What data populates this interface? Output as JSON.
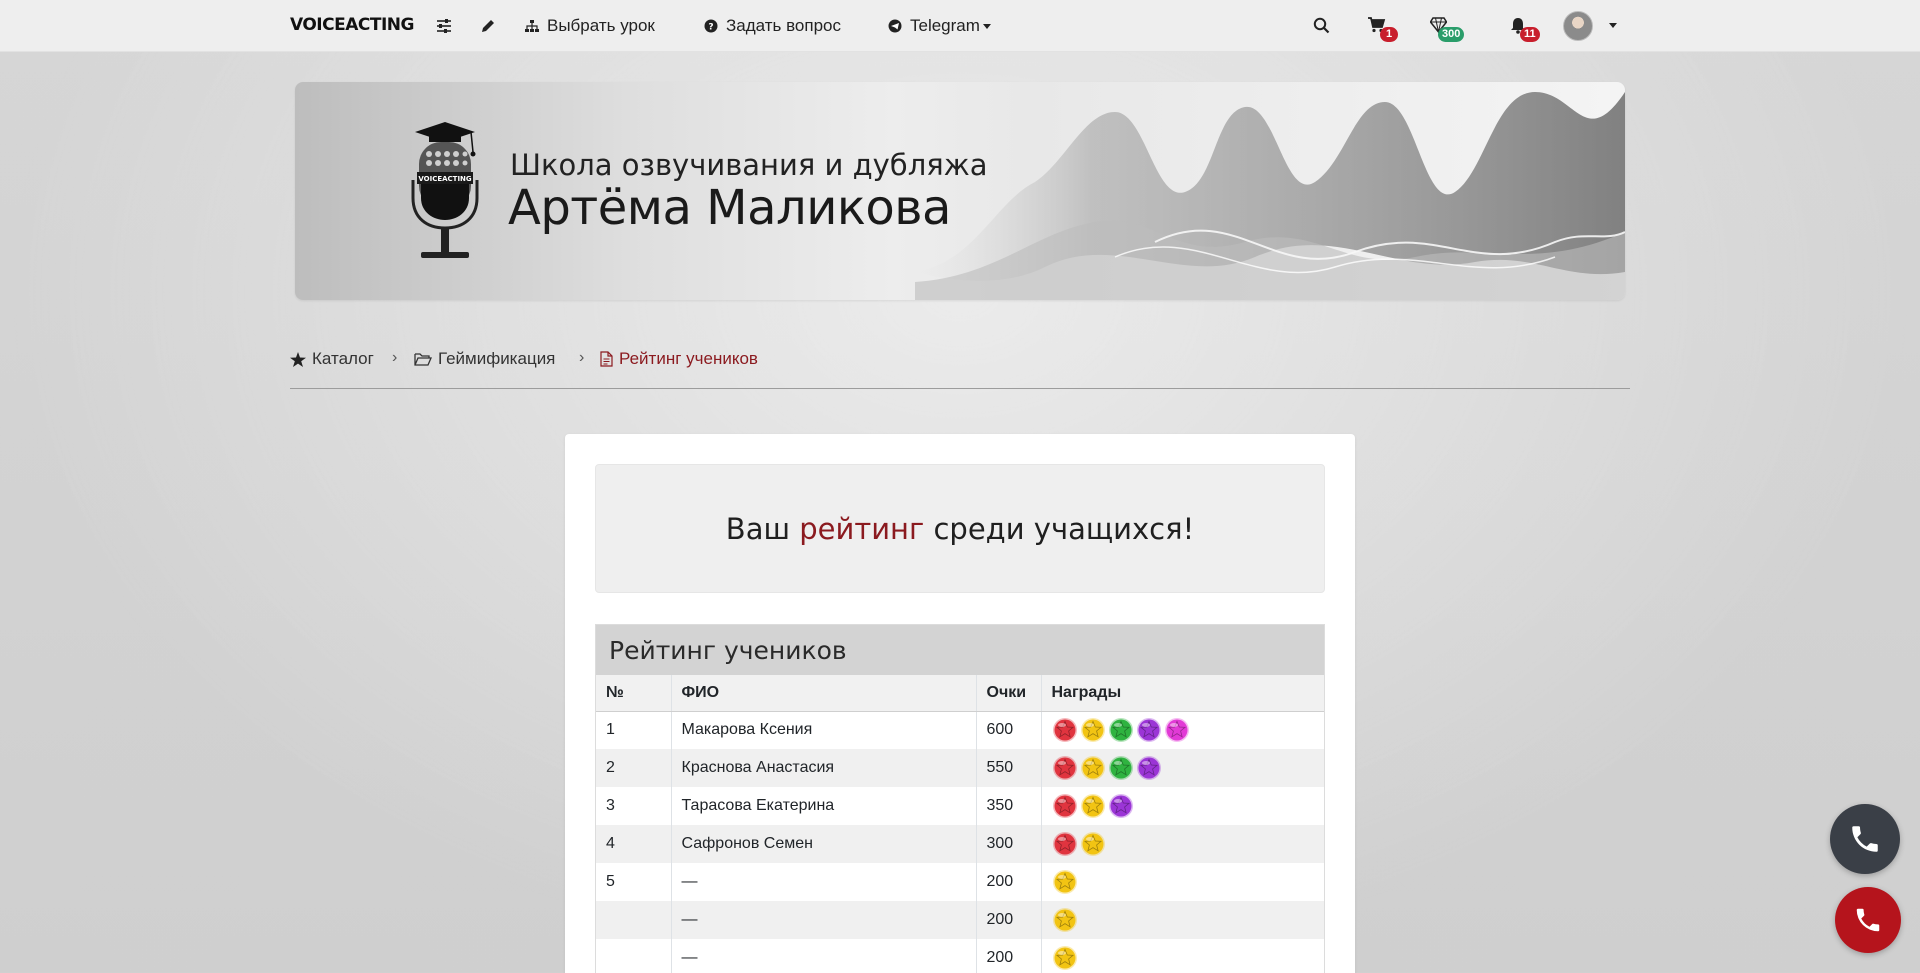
{
  "navbar": {
    "brand": "VOICEACTING",
    "items": [
      {
        "label": "Выбрать урок"
      },
      {
        "label": "Задать вопрос"
      },
      {
        "label": "Telegram"
      }
    ],
    "cart_count": "1",
    "gems_count": "300",
    "notifications_count": "11",
    "colors": {
      "badge_red": "#c81e2c",
      "badge_green": "#2a9d6a"
    }
  },
  "banner": {
    "line1": "Школа озвучивания и дубляжа",
    "line2": "Артёма Маликова",
    "mic_label": "VOICEACTING"
  },
  "breadcrumb": {
    "items": [
      {
        "label": "Каталог"
      },
      {
        "label": "Геймификация"
      },
      {
        "label": "Рейтинг учеников"
      }
    ],
    "separator": "›"
  },
  "hero": {
    "before": "Ваш",
    "accent": "рейтинг",
    "after": "среди учащихся!",
    "accent_color": "#8b1a1f"
  },
  "rating": {
    "title": "Рейтинг учеников",
    "columns": [
      "№",
      "ФИО",
      "Очки",
      "Награды"
    ],
    "rows": [
      {
        "rank": "1",
        "name": "Макарова Ксения",
        "points": "600",
        "awards": [
          "red",
          "yellow",
          "green",
          "purple",
          "pink"
        ]
      },
      {
        "rank": "2",
        "name": "Краснова Анастасия",
        "points": "550",
        "awards": [
          "red",
          "yellow",
          "green",
          "purple"
        ]
      },
      {
        "rank": "3",
        "name": "Тарасова Екатерина",
        "points": "350",
        "awards": [
          "red",
          "yellow",
          "purple"
        ]
      },
      {
        "rank": "4",
        "name": "Сафронов Семен",
        "points": "300",
        "awards": [
          "red",
          "yellow"
        ]
      },
      {
        "rank": "5",
        "name": "—",
        "points": "200",
        "awards": [
          "yellow"
        ]
      },
      {
        "rank": "",
        "name": "—",
        "points": "200",
        "awards": [
          "yellow"
        ]
      },
      {
        "rank": "",
        "name": "—",
        "points": "200",
        "awards": [
          "yellow"
        ]
      }
    ],
    "award_colors": {
      "red": "#e0343f",
      "yellow": "#f2c413",
      "green": "#2fb340",
      "purple": "#9b35d6",
      "pink": "#e23ad6"
    }
  },
  "fab": {
    "top_color": "#3a3f47",
    "bottom_color": "#b5141c"
  }
}
